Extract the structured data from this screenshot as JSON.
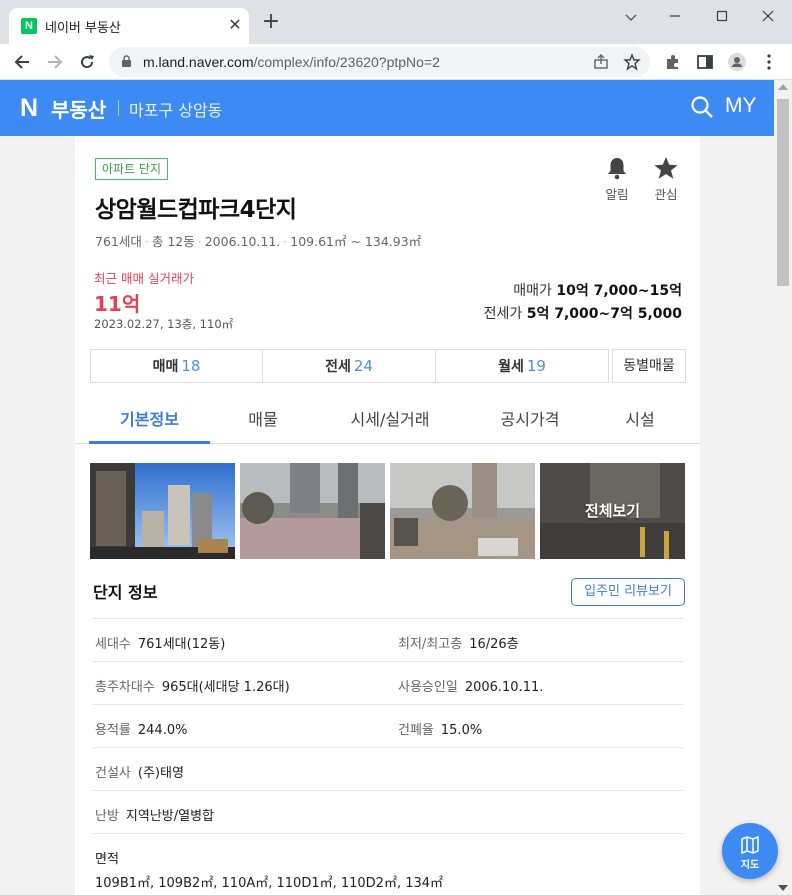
{
  "browser": {
    "tab_title": "네이버 부동산",
    "favicon_letter": "N",
    "url_host": "m.land.naver.com",
    "url_path": "/complex/info/23620?ptpNo=2",
    "new_tab": "+",
    "close_tab": "✕"
  },
  "header": {
    "logo": "N",
    "brand": "부동산",
    "location": "마포구 상암동",
    "my": "MY",
    "color": "#3d8bf2"
  },
  "complex": {
    "badge": "아파트 단지",
    "title": "상암월드컵파크4단지",
    "households": "761세대",
    "buildings": "총 12동",
    "approval_date": "2006.10.11.",
    "area_range": "109.61㎡ ~ 134.93㎡",
    "actions": {
      "alert": "알림",
      "favorite": "관심"
    }
  },
  "recent": {
    "label": "최근 매매 실거래가",
    "price": "11억",
    "detail": "2023.02.27, 13층, 110㎡"
  },
  "prices": {
    "sale_label": "매매가",
    "sale_value": "10억 7,000~15억",
    "jeonse_label": "전세가",
    "jeonse_value": "5억 7,000~7억 5,000"
  },
  "trades": {
    "sale_label": "매매",
    "sale_count": "18",
    "jeonse_label": "전세",
    "jeonse_count": "24",
    "monthly_label": "월세",
    "monthly_count": "19",
    "by_building": "동별매물"
  },
  "tabs": [
    "기본정보",
    "매물",
    "시세/실거래",
    "공시가격",
    "시설"
  ],
  "photos": {
    "view_all": "전체보기"
  },
  "info_section": {
    "title": "단지 정보",
    "review_button": "입주민 리뷰보기",
    "households_label": "세대수",
    "households_value": "761세대(12동)",
    "floors_label": "최저/최고층",
    "floors_value": "16/26층",
    "parking_label": "총주차대수",
    "parking_value": "965대(세대당 1.26대)",
    "approval_label": "사용승인일",
    "approval_value": "2006.10.11.",
    "far_label": "용적률",
    "far_value": "244.0%",
    "bcr_label": "건폐율",
    "bcr_value": "15.0%",
    "builder_label": "건설사",
    "builder_value": "(주)태영",
    "heating_label": "난방",
    "heating_value": "지역난방/열병합",
    "area_label": "면적",
    "area_value": "109B1㎡, 109B2㎡, 110A㎡, 110D1㎡, 110D2㎡, 134㎡"
  },
  "map_button": {
    "label": "지도"
  }
}
